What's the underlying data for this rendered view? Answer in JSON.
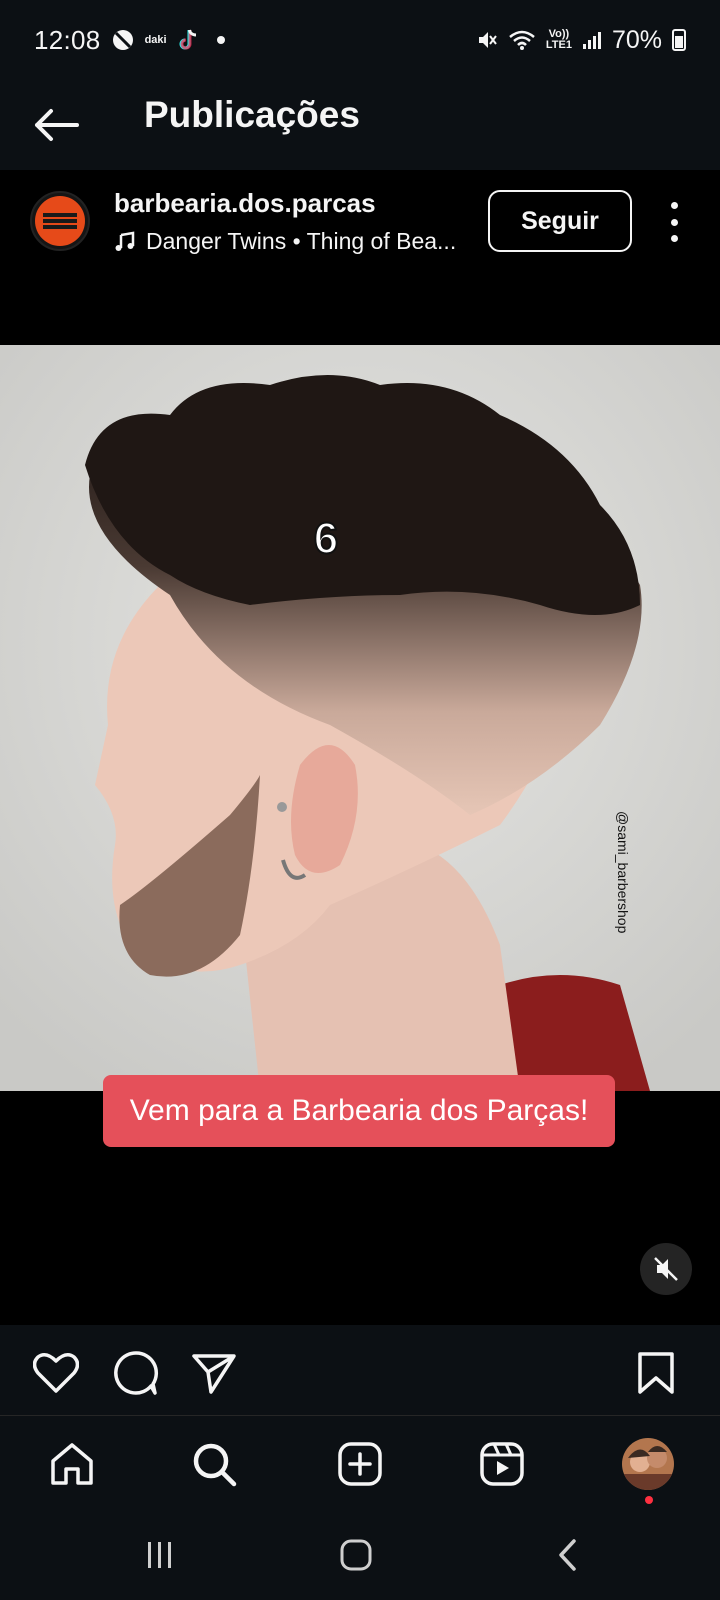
{
  "status_bar": {
    "time": "12:08",
    "carrier_badge": "daki",
    "network": "Vo))\nLTE1",
    "battery": "70%"
  },
  "header": {
    "title": "Publicações"
  },
  "post": {
    "username": "barbearia.dos.parcas",
    "avatar_text": "BARBEARIA PARÇAS",
    "music": "Danger Twins • Thing of Bea...",
    "follow_label": "Seguir",
    "media": {
      "overlay_number": "6",
      "watermark": "@sami_barbershop",
      "caption": "Vem para a Barbearia dos Parças!",
      "muted": true
    }
  },
  "colors": {
    "background": "#0c1014",
    "caption_chip": "#e5505a",
    "notification": "#ff3040"
  },
  "icons": {
    "back": "arrow-left-icon",
    "music": "music-note-icon",
    "more": "more-vertical-icon",
    "mute": "speaker-muted-icon",
    "like": "heart-icon",
    "comment": "comment-icon",
    "share": "send-icon",
    "save": "bookmark-icon",
    "home": "home-icon",
    "search": "search-icon",
    "create": "plus-square-icon",
    "reels": "reels-icon",
    "profile": "profile-avatar-icon"
  }
}
